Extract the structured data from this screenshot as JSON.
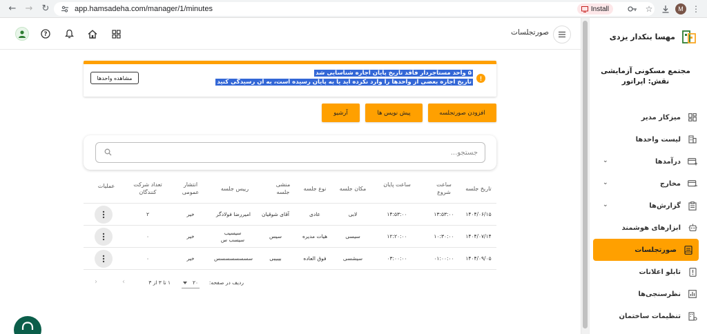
{
  "browser": {
    "url": "app.hamsadeha.com/manager/1/minutes",
    "install_label": "Install",
    "profile_initial": "M"
  },
  "sidebar": {
    "brand_name": "مهسا بنکدار یزدی",
    "complex_name": "مجتمع مسکونی آزمایشی",
    "role": "نقش: اپراتور",
    "items": [
      {
        "label": "میزکار مدیر",
        "icon": "dashboard-icon"
      },
      {
        "label": "لیست واحدها",
        "icon": "building-icon"
      },
      {
        "label": "درآمدها",
        "icon": "income-card-icon",
        "expandable": true
      },
      {
        "label": "مخارج",
        "icon": "expense-card-icon",
        "expandable": true
      },
      {
        "label": "گزارش‌ها",
        "icon": "clipboard-icon",
        "expandable": true
      },
      {
        "label": "ابزارهای هوشمند",
        "icon": "robot-icon"
      },
      {
        "label": "صورتجلسات",
        "icon": "minutes-icon",
        "active": true
      },
      {
        "label": "تابلو اعلانات",
        "icon": "notice-board-icon"
      },
      {
        "label": "نظرسنجی‌ها",
        "icon": "poll-icon"
      },
      {
        "label": "تنظیمات ساختمان",
        "icon": "building-settings-icon"
      }
    ]
  },
  "header": {
    "page_title": "صورتجلسات"
  },
  "alert": {
    "line1": "۵ واحد مستاجردار فاقد تاریخ پایان اجاره شناسایی شد",
    "line2": "تاریخ اجاره بعضی از واحدها را وارد نکرده اید یا به پایان رسیده است، به آن رسیدگی کنید",
    "button_label": "مشاهده واحدها"
  },
  "actions": {
    "add_label": "افزودن صورتجلسه",
    "drafts_label": "پیش نویس ها",
    "archive_label": "آرشیو"
  },
  "search": {
    "placeholder": "جستجو..."
  },
  "table": {
    "headers": {
      "date": "تاریخ جلسه",
      "start": "ساعت شروع",
      "end": "ساعت پایان",
      "place": "مکان جلسه",
      "type": "نوع جلسه",
      "secretary": "منشی جلسه",
      "chair": "رییس جلسه",
      "public": "انتشار عمومی",
      "participants": "تعداد شرکت کنندگان",
      "ops": "عملیات"
    },
    "rows": [
      {
        "date": "۱۴۰۴/۰۶/۱۵",
        "start": "۱۳:۵۳:۰۰",
        "end": "۱۴:۵۳:۰۰",
        "place": "لابی",
        "type": "عادی",
        "secretary": "آقای شوقیان",
        "chair": "امیررضا فولادگر",
        "public": "خیر",
        "participants": "۲"
      },
      {
        "date": "۱۴۰۴/۰۷/۱۴",
        "start": "۱۰:۳۰:۰۰",
        "end": "۱۲:۲۰:۰۰",
        "place": "سیسی",
        "type": "هیات مدیره",
        "secretary": "سیس",
        "chair": "سیسیب سیسب س",
        "public": "خیر",
        "participants": "۰"
      },
      {
        "date": "۱۴۰۴/۰۹/۰۵",
        "start": "۰۱:۰۰:۰۰",
        "end": "۰۳:۰۰:۰۰",
        "place": "سیشسی",
        "type": "فوق العاده",
        "secretary": "بیبیبی",
        "chair": "سسسسسسسس",
        "public": "خیر",
        "participants": "۰"
      }
    ]
  },
  "pagination": {
    "rows_label": "ردیف در صفحه:",
    "rows_value": "۲۰",
    "range": "۱ تا ۳ از ۳"
  }
}
